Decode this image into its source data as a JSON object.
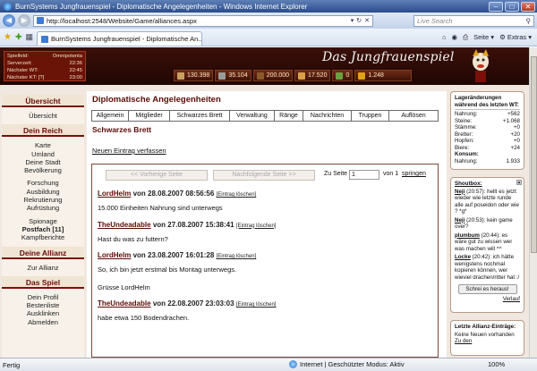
{
  "browser": {
    "title": "BurnSystems Jungfrauenspiel - Diplomatische Angelegenheiten - Windows Internet Explorer",
    "url": "http://localhost:2548/Website/Game/alliances.aspx",
    "search_placeholder": "Live Search",
    "tab_title": "BurnSystems Jungfrauenspiel - Diplomatische An...",
    "cmd_page": "Seite",
    "cmd_extras": "Extras",
    "status_text": "Fertig",
    "zone_text": "Internet | Geschützter Modus: Aktiv",
    "zoom": "100%"
  },
  "server_info": [
    {
      "label": "Spielfeld:",
      "value": "Omnipotenta"
    },
    {
      "label": "Serverzeit:",
      "value": "22:36"
    },
    {
      "label": "Nächster WT:",
      "value": "22:45"
    },
    {
      "label": "Nächster KT: [?]",
      "value": "23:00"
    }
  ],
  "logo": "Das Jungfrauenspiel",
  "resources": [
    {
      "name": "nahrung",
      "value": "130.398",
      "color": "#c8a060"
    },
    {
      "name": "steine",
      "value": "35.104",
      "color": "#9a9a9a"
    },
    {
      "name": "staemme",
      "value": "200.000",
      "color": "#8a5a2a"
    },
    {
      "name": "bretter",
      "value": "17.520",
      "color": "#d8a048"
    },
    {
      "name": "hopfen",
      "value": "0",
      "color": "#6aa040"
    },
    {
      "name": "bier",
      "value": "1.248",
      "color": "#e0a020"
    }
  ],
  "nav": {
    "sections": [
      {
        "title": "Übersicht",
        "items": [
          "Übersicht"
        ]
      },
      {
        "title": "Dein Reich",
        "items": [
          "Karte",
          "Umland",
          "Deine Stadt",
          "Bevölkerung",
          "",
          "Forschung",
          "Ausbildung",
          "Rekrutierung",
          "Aufrüstung",
          "",
          "Spionage",
          "Postfach [11]",
          "Kampfberichte"
        ]
      },
      {
        "title": "Deine Allianz",
        "items": [
          "Zur Allianz"
        ]
      },
      {
        "title": "Das Spiel",
        "items": [
          "Dein Profil",
          "Bestenliste",
          "Ausklinken",
          "Abmelden"
        ]
      }
    ]
  },
  "main": {
    "heading": "Diplomatische Angelegenheiten",
    "tabs": [
      "Allgemein",
      "Mitglieder",
      "Schwarzes Brett",
      "Verwaltung",
      "Ränge",
      "Nachrichten",
      "Truppen",
      "Auflösen"
    ],
    "subheading": "Schwarzes Brett",
    "new_entry": "Neuen Eintrag verfassen",
    "pager": {
      "prev": "<< Vorherige Seite",
      "next": "Nachfolgende Seite >>",
      "goto_label": "Zu Seite",
      "page_value": "1",
      "of_label": "von 1",
      "jump": "springen"
    },
    "entries": [
      {
        "author": "LordHelm",
        "date": "von 28.08.2007 08:56:56",
        "delete": "[Eintrag löschen]",
        "lines": [
          "15.000 Einheiten Nahrung sind unterwegs"
        ]
      },
      {
        "author": "TheUndeadable",
        "date": "von 27.08.2007 15:38:41",
        "delete": "[Eintrag löschen]",
        "lines": [
          "Hast du was zu futtern?"
        ]
      },
      {
        "author": "LordHelm",
        "date": "von 23.08.2007 16:01:28",
        "delete": "[Eintrag löschen]",
        "lines": [
          "So, ich bin jetzt erstmal bis Montag unterwegs.",
          "Grüsse LordHelm"
        ]
      },
      {
        "author": "TheUndeadable",
        "date": "von 22.08.2007 23:03:03",
        "delete": "[Eintrag löschen]",
        "lines": [
          "habe etwa 150 Bodendrachen."
        ]
      }
    ]
  },
  "sidebar": {
    "storage_title": "Lageränderungen während des letzten WT:",
    "storage": [
      {
        "label": "Nahrung:",
        "value": "+562"
      },
      {
        "label": "Steine:",
        "value": "+1.068"
      },
      {
        "label": "Stämme:",
        "value": "+0"
      },
      {
        "label": "Bretter:",
        "value": "+20"
      },
      {
        "label": "Hopfen:",
        "value": "+0"
      },
      {
        "label": "Biere:",
        "value": "+24"
      }
    ],
    "konsum_label": "Konsum:",
    "konsum_value": "",
    "nahrung2_label": "Nahrung:",
    "nahrung2_value": "1.933",
    "shoutbox_title": "Shoutbox:",
    "shouts": [
      {
        "nick": "Neji",
        "text": "(20:57): hellt es jetzt wieder wie letzte runde alle auf poseidon oder wie ? *g*"
      },
      {
        "nick": "Neji",
        "text": "(20:53): kein game over?"
      },
      {
        "nick": "plumbum",
        "text": "(20:44): es wäre gut zu wissen wer was machen will ^^"
      },
      {
        "nick": "Locke",
        "text": "(20:42): ich hätte wenigstens nochmal kopieren können, wer wieviel drachen/ritter hat :/"
      }
    ],
    "shout_button": "Schrei es heraus!",
    "history": "Verlauf",
    "alliance_title": "Letzte Allianz-Einträge:",
    "alliance_text": "Keine Neuen vorhanden",
    "alliance_link": "Zu den"
  }
}
